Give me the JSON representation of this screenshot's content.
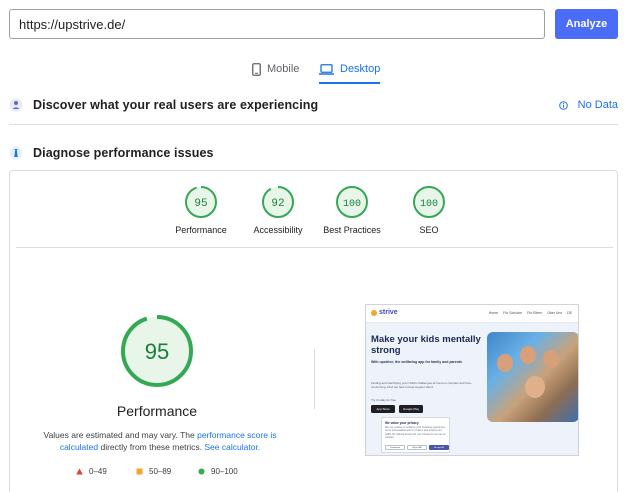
{
  "url_bar": {
    "value": "https://upstrive.de/",
    "analyze_label": "Analyze"
  },
  "tabs": [
    {
      "label": "Mobile",
      "icon": "smartphone-icon",
      "selected": false
    },
    {
      "label": "Desktop",
      "icon": "laptop-icon",
      "selected": true
    }
  ],
  "discover": {
    "title": "Discover what your real users are experiencing",
    "no_data_label": "No Data",
    "icon": "people-icon"
  },
  "diagnose": {
    "title": "Diagnose performance issues",
    "icon": "lighthouse-icon"
  },
  "scores": [
    {
      "label": "Performance",
      "value": 95
    },
    {
      "label": "Accessibility",
      "value": 92
    },
    {
      "label": "Best Practices",
      "value": 100
    },
    {
      "label": "SEO",
      "value": 100
    }
  ],
  "performance_detail": {
    "value": 95,
    "title": "Performance",
    "explain_prefix": "Values are estimated and may vary. The ",
    "explain_link": "performance score is calculated",
    "explain_mid": " directly from these metrics. ",
    "explain_link2": "See calculator."
  },
  "legend": [
    {
      "range": "0–49",
      "color": "#e2402d",
      "shape": "triangle"
    },
    {
      "range": "50–89",
      "color": "#f4a62a",
      "shape": "square"
    },
    {
      "range": "90–100",
      "color": "#34a853",
      "shape": "circle"
    }
  ],
  "colors": {
    "accent": "#1a73e8",
    "analyze": "#4a6cf7",
    "pass": "#34a853",
    "pass_fill": "#e8f5e9"
  },
  "screenshot": {
    "logo": "strive",
    "nav_links": [
      "Home",
      "Für Schulen",
      "Für Eltern",
      "Über Uns",
      "DE"
    ],
    "headline": "Make your kids mentally strong",
    "subhead": "With upstrive, the wellbeing app for family and parents",
    "body": "Finding and identifying your child's challenges at home is complex and time-consuming. Find out how to best support them!",
    "small": "Try it today for free",
    "store_apple": "App Store",
    "store_google": "Google Play",
    "cookie_title": "We value your privacy",
    "cookie_text": "We use cookies to enhance your browsing experience, serve personalized ads or content, and analyze our traffic. By clicking Accept All, you consent to our use of cookies.",
    "cookie_buttons": [
      "Customize",
      "Reject All",
      "Accept All"
    ]
  }
}
